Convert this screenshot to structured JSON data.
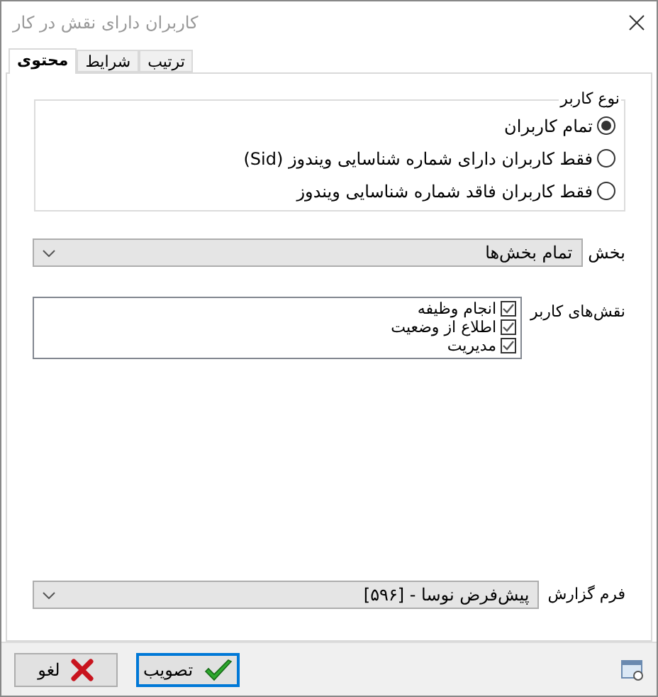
{
  "window": {
    "title": "کاربران دارای نقش در کار"
  },
  "tabs": [
    {
      "label": "ترتیب",
      "selected": false
    },
    {
      "label": "شرایط",
      "selected": false
    },
    {
      "label": "محتوی",
      "selected": true
    }
  ],
  "user_type": {
    "legend": "نوع کاربر",
    "options": [
      {
        "label": "تمام کاربران",
        "selected": true
      },
      {
        "label": "فقط کاربران دارای شماره شناسایی ویندوز (Sid)",
        "selected": false
      },
      {
        "label": "فقط کاربران فاقد شماره شناسایی ویندوز",
        "selected": false
      }
    ]
  },
  "section": {
    "label": "بخش",
    "value": "تمام بخش‌ها"
  },
  "roles": {
    "label": "نقش‌های کاربر",
    "items": [
      {
        "label": "انجام وظیفه",
        "checked": true
      },
      {
        "label": "اطلاع از وضعیت",
        "checked": true
      },
      {
        "label": "مدیریت",
        "checked": true
      }
    ]
  },
  "report_form": {
    "label": "فرم گزارش",
    "value": "پیش‌فرض نوسا - [۵۹۶]"
  },
  "buttons": [
    {
      "label": "تصویب",
      "kind": "ok"
    },
    {
      "label": "لغو",
      "kind": "cancel"
    }
  ]
}
